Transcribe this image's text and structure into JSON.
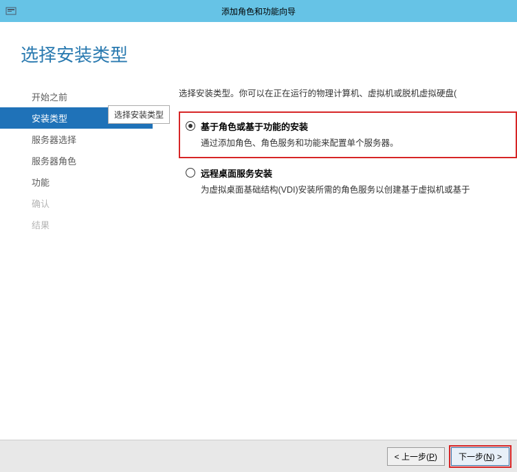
{
  "titlebar": {
    "title": "添加角色和功能向导"
  },
  "page": {
    "heading": "选择安装类型"
  },
  "sidebar": {
    "items": [
      {
        "label": "开始之前",
        "state": "normal"
      },
      {
        "label": "安装类型",
        "state": "active"
      },
      {
        "label": "服务器选择",
        "state": "normal"
      },
      {
        "label": "服务器角色",
        "state": "normal"
      },
      {
        "label": "功能",
        "state": "normal"
      },
      {
        "label": "确认",
        "state": "disabled"
      },
      {
        "label": "结果",
        "state": "disabled"
      }
    ],
    "tooltip": "选择安装类型"
  },
  "main": {
    "intro": "选择安装类型。你可以在正在运行的物理计算机、虚拟机或脱机虚拟硬盘(",
    "options": [
      {
        "title": "基于角色或基于功能的安装",
        "desc": "通过添加角色、角色服务和功能来配置单个服务器。",
        "selected": true,
        "highlighted": true
      },
      {
        "title": "远程桌面服务安装",
        "desc": "为虚拟桌面基础结构(VDI)安装所需的角色服务以创建基于虚拟机或基于",
        "selected": false,
        "highlighted": false
      }
    ]
  },
  "footer": {
    "prev_label": "< 上一步(P)",
    "next_label": "下一步(N) >"
  }
}
